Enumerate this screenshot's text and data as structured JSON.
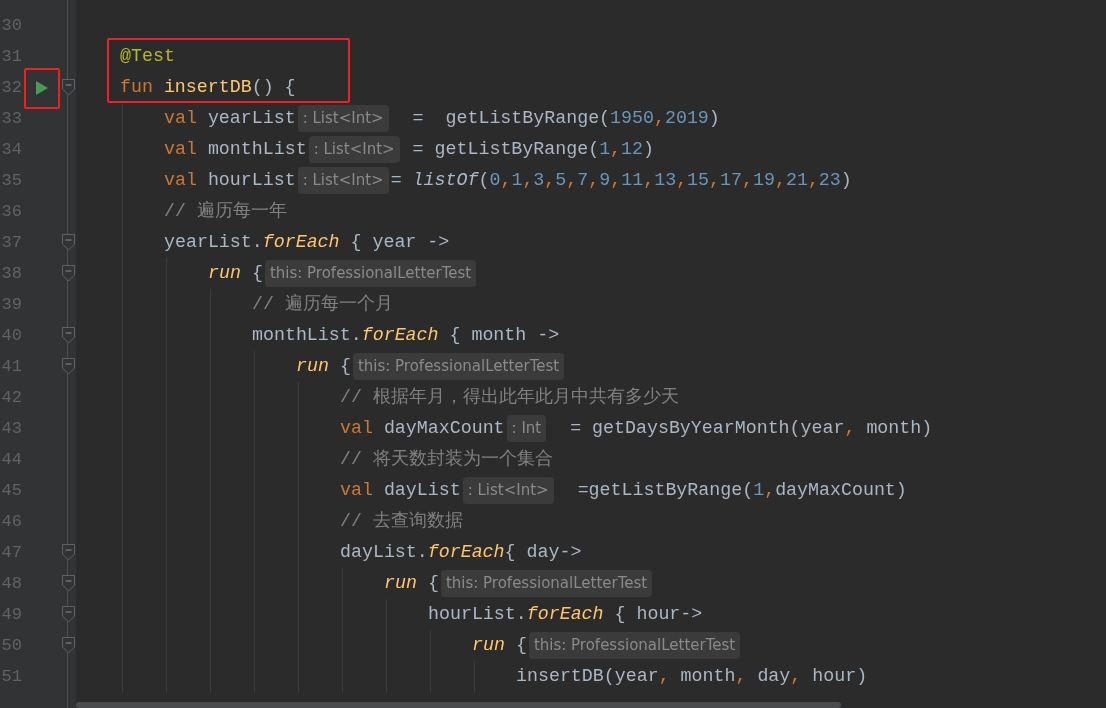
{
  "editor": {
    "lines": [
      {
        "number": "30"
      },
      {
        "number": "31",
        "boxed": true,
        "tokens": [
          {
            "kind": "annotation",
            "text": "@Test"
          }
        ]
      },
      {
        "number": "32",
        "boxed": true,
        "run_marker": true,
        "icon_boxed": true,
        "foldable": true,
        "tokens": [
          {
            "kind": "keyword",
            "text": "fun "
          },
          {
            "kind": "function",
            "text": "insertDB"
          },
          {
            "kind": "plain",
            "text": "() {"
          }
        ],
        "children": [
          {
            "number": "33",
            "tokens": [
              {
                "kind": "keyword",
                "text": "val "
              },
              {
                "kind": "plain",
                "text": "yearList"
              },
              {
                "kind": "hint",
                "text": ": List<Int>"
              },
              {
                "kind": "plain",
                "text": "  =  getListByRange("
              },
              {
                "kind": "number",
                "text": "1950"
              },
              {
                "kind": "comma",
                "text": ","
              },
              {
                "kind": "number",
                "text": "2019"
              },
              {
                "kind": "plain",
                "text": ")"
              }
            ]
          },
          {
            "number": "34",
            "tokens": [
              {
                "kind": "keyword",
                "text": "val "
              },
              {
                "kind": "plain",
                "text": "monthList"
              },
              {
                "kind": "hint",
                "text": ": List<Int>"
              },
              {
                "kind": "plain",
                "text": " = getListByRange("
              },
              {
                "kind": "number",
                "text": "1"
              },
              {
                "kind": "comma",
                "text": ","
              },
              {
                "kind": "number",
                "text": "12"
              },
              {
                "kind": "plain",
                "text": ")"
              }
            ]
          },
          {
            "number": "35",
            "tokens": [
              {
                "kind": "keyword",
                "text": "val "
              },
              {
                "kind": "plain",
                "text": "hourList"
              },
              {
                "kind": "hint",
                "text": ": List<Int>"
              },
              {
                "kind": "plain",
                "text": "= "
              },
              {
                "kind": "call",
                "text": "listOf"
              },
              {
                "kind": "plain",
                "text": "("
              },
              {
                "kind": "number",
                "text": "0"
              },
              {
                "kind": "comma",
                "text": ","
              },
              {
                "kind": "number",
                "text": "1"
              },
              {
                "kind": "comma",
                "text": ","
              },
              {
                "kind": "number",
                "text": "3"
              },
              {
                "kind": "comma",
                "text": ","
              },
              {
                "kind": "number",
                "text": "5"
              },
              {
                "kind": "comma",
                "text": ","
              },
              {
                "kind": "number",
                "text": "7"
              },
              {
                "kind": "comma",
                "text": ","
              },
              {
                "kind": "number",
                "text": "9"
              },
              {
                "kind": "comma",
                "text": ","
              },
              {
                "kind": "number",
                "text": "11"
              },
              {
                "kind": "comma",
                "text": ","
              },
              {
                "kind": "number",
                "text": "13"
              },
              {
                "kind": "comma",
                "text": ","
              },
              {
                "kind": "number",
                "text": "15"
              },
              {
                "kind": "comma",
                "text": ","
              },
              {
                "kind": "number",
                "text": "17"
              },
              {
                "kind": "comma",
                "text": ","
              },
              {
                "kind": "number",
                "text": "19"
              },
              {
                "kind": "comma",
                "text": ","
              },
              {
                "kind": "number",
                "text": "21"
              },
              {
                "kind": "comma",
                "text": ","
              },
              {
                "kind": "number",
                "text": "23"
              },
              {
                "kind": "plain",
                "text": ")"
              }
            ]
          },
          {
            "number": "36",
            "tokens": [
              {
                "kind": "comment",
                "text": "// 遍历每一年"
              }
            ]
          },
          {
            "number": "37",
            "foldable": true,
            "tokens": [
              {
                "kind": "plain",
                "text": "yearList."
              },
              {
                "kind": "lambda",
                "text": "forEach"
              },
              {
                "kind": "plain",
                "text": " { year ->"
              }
            ],
            "children": [
              {
                "number": "38",
                "foldable": true,
                "tokens": [
                  {
                    "kind": "lambda",
                    "text": "run"
                  },
                  {
                    "kind": "plain",
                    "text": " {"
                  },
                  {
                    "kind": "hint",
                    "text": "this: ProfessionalLetterTest"
                  }
                ],
                "children": [
                  {
                    "number": "39",
                    "tokens": [
                      {
                        "kind": "comment",
                        "text": "// 遍历每一个月"
                      }
                    ]
                  },
                  {
                    "number": "40",
                    "foldable": true,
                    "tokens": [
                      {
                        "kind": "plain",
                        "text": "monthList."
                      },
                      {
                        "kind": "lambda",
                        "text": "forEach"
                      },
                      {
                        "kind": "plain",
                        "text": " { month ->"
                      }
                    ],
                    "children": [
                      {
                        "number": "41",
                        "foldable": true,
                        "tokens": [
                          {
                            "kind": "lambda",
                            "text": "run"
                          },
                          {
                            "kind": "plain",
                            "text": " {"
                          },
                          {
                            "kind": "hint",
                            "text": "this: ProfessionalLetterTest"
                          }
                        ],
                        "children": [
                          {
                            "number": "42",
                            "tokens": [
                              {
                                "kind": "comment",
                                "text": "// 根据年月，得出此年此月中共有多少天"
                              }
                            ]
                          },
                          {
                            "number": "43",
                            "tokens": [
                              {
                                "kind": "keyword",
                                "text": "val "
                              },
                              {
                                "kind": "plain",
                                "text": "dayMaxCount"
                              },
                              {
                                "kind": "hint",
                                "text": ": Int"
                              },
                              {
                                "kind": "plain",
                                "text": "  = getDaysByYearMonth(year"
                              },
                              {
                                "kind": "comma",
                                "text": ", "
                              },
                              {
                                "kind": "plain",
                                "text": "month)"
                              }
                            ]
                          },
                          {
                            "number": "44",
                            "tokens": [
                              {
                                "kind": "comment",
                                "text": "// 将天数封装为一个集合"
                              }
                            ]
                          },
                          {
                            "number": "45",
                            "tokens": [
                              {
                                "kind": "keyword",
                                "text": "val "
                              },
                              {
                                "kind": "plain",
                                "text": "dayList"
                              },
                              {
                                "kind": "hint",
                                "text": ": List<Int>"
                              },
                              {
                                "kind": "plain",
                                "text": "  =getListByRange("
                              },
                              {
                                "kind": "number",
                                "text": "1"
                              },
                              {
                                "kind": "comma",
                                "text": ","
                              },
                              {
                                "kind": "plain",
                                "text": "dayMaxCount)"
                              }
                            ]
                          },
                          {
                            "number": "46",
                            "tokens": [
                              {
                                "kind": "comment",
                                "text": "// 去查询数据"
                              }
                            ]
                          },
                          {
                            "number": "47",
                            "foldable": true,
                            "tokens": [
                              {
                                "kind": "plain",
                                "text": "dayList."
                              },
                              {
                                "kind": "lambda",
                                "text": "forEach"
                              },
                              {
                                "kind": "plain",
                                "text": "{ day->"
                              }
                            ],
                            "children": [
                              {
                                "number": "48",
                                "foldable": true,
                                "tokens": [
                                  {
                                    "kind": "lambda",
                                    "text": "run"
                                  },
                                  {
                                    "kind": "plain",
                                    "text": " {"
                                  },
                                  {
                                    "kind": "hint",
                                    "text": "this: ProfessionalLetterTest"
                                  }
                                ],
                                "children": [
                                  {
                                    "number": "49",
                                    "foldable": true,
                                    "tokens": [
                                      {
                                        "kind": "plain",
                                        "text": "hourList."
                                      },
                                      {
                                        "kind": "lambda",
                                        "text": "forEach"
                                      },
                                      {
                                        "kind": "plain",
                                        "text": " { hour->"
                                      }
                                    ],
                                    "children": [
                                      {
                                        "number": "50",
                                        "foldable": true,
                                        "tokens": [
                                          {
                                            "kind": "lambda",
                                            "text": "run"
                                          },
                                          {
                                            "kind": "plain",
                                            "text": " {"
                                          },
                                          {
                                            "kind": "hint",
                                            "text": "this: ProfessionalLetterTest"
                                          }
                                        ],
                                        "children": [
                                          {
                                            "number": "51",
                                            "tokens": [
                                              {
                                                "kind": "plain",
                                                "text": "insertDB(year"
                                              },
                                              {
                                                "kind": "comma",
                                                "text": ", "
                                              },
                                              {
                                                "kind": "plain",
                                                "text": "month"
                                              },
                                              {
                                                "kind": "comma",
                                                "text": ", "
                                              },
                                              {
                                                "kind": "plain",
                                                "text": "day"
                                              },
                                              {
                                                "kind": "comma",
                                                "text": ", "
                                              },
                                              {
                                                "kind": "plain",
                                                "text": "hour)"
                                              }
                                            ]
                                          }
                                        ]
                                      }
                                    ]
                                  }
                                ]
                              }
                            ]
                          }
                        ]
                      }
                    ]
                  }
                ]
              }
            ]
          }
        ]
      }
    ]
  }
}
